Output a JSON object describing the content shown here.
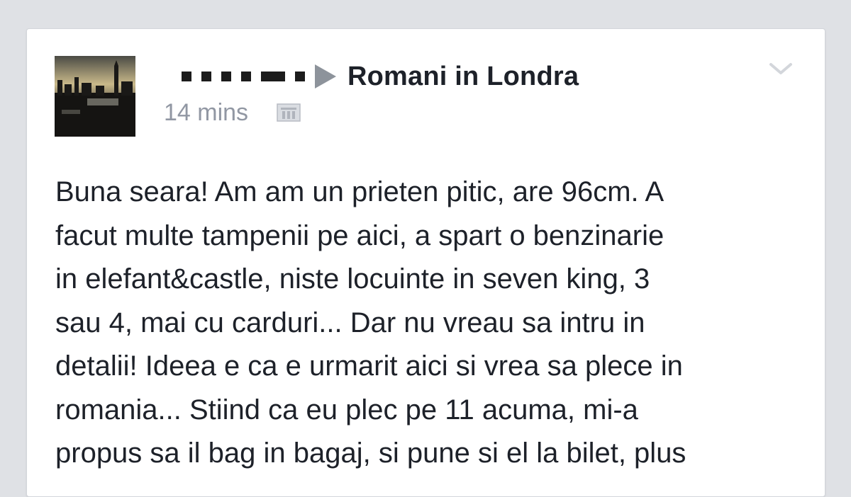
{
  "post": {
    "author_redacted": true,
    "group_name": "Romani in Londra",
    "timestamp": "14 mins",
    "privacy_icon": "group-members-icon",
    "menu_icon": "chevron-down-icon",
    "avatar_icon": "city-skyline-photo",
    "body_lines": [
      "Buna seara! Am am un prieten pitic, are 96cm. A",
      "facut multe tampenii pe aici, a spart o benzinarie",
      "in elefant&castle, niste locuinte in seven king, 3",
      "sau 4, mai cu carduri... Dar nu vreau sa intru in",
      "detalii! Ideea e ca e urmarit aici si vrea sa plece in",
      "romania... Stiind ca eu plec pe 11 acuma, mi-a",
      "propus sa il bag in bagaj, si pune si el la bilet, plus"
    ]
  },
  "colors": {
    "background": "#dfe1e5",
    "card": "#ffffff",
    "text": "#1d2129",
    "muted": "#9197a3"
  }
}
